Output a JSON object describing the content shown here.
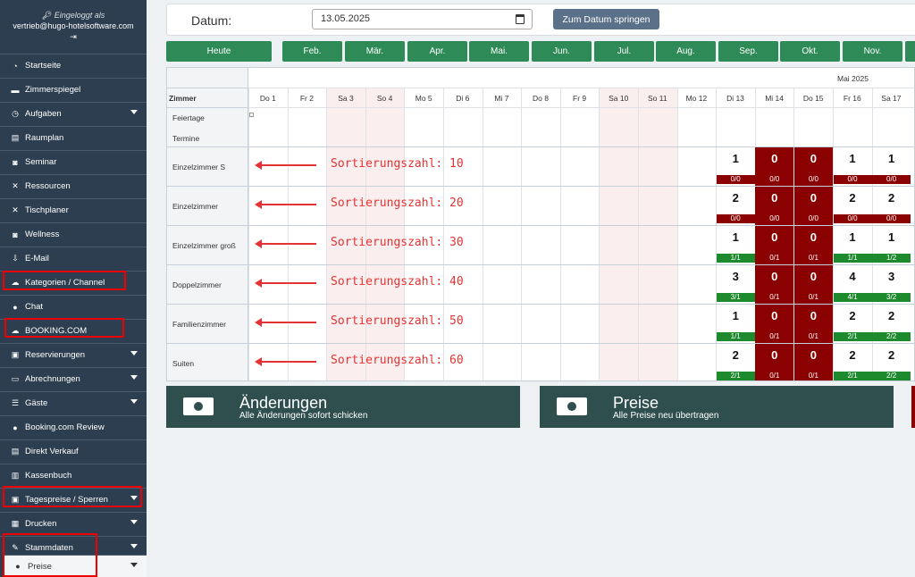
{
  "sidebar": {
    "logged_in_label": "Eingeloggt als",
    "email": "vertrieb@hugo-hotelsoftware.com",
    "logout_glyph": "⇥",
    "items": [
      {
        "label": "Startseite",
        "icon": "speedometer-icon"
      },
      {
        "label": "Zimmerspiegel",
        "icon": "bed-icon"
      },
      {
        "label": "Aufgaben",
        "icon": "clock-icon"
      },
      {
        "label": "Raumplan",
        "icon": "building-icon"
      },
      {
        "label": "Seminar",
        "icon": "cup-icon"
      },
      {
        "label": "Ressourcen",
        "icon": "tools-icon"
      },
      {
        "label": "Tischplaner",
        "icon": "cutlery-icon"
      },
      {
        "label": "Wellness",
        "icon": "spa-icon"
      },
      {
        "label": "E-Mail",
        "icon": "mail-icon"
      },
      {
        "label": "Kategorien / Channel",
        "icon": "cloud-icon"
      },
      {
        "label": "Chat",
        "icon": "chat-icon"
      },
      {
        "label": "BOOKING.COM",
        "icon": "cloud-icon"
      },
      {
        "label": "Reservierungen",
        "icon": "briefcase-icon"
      },
      {
        "label": "Abrechnungen",
        "icon": "cash-icon"
      },
      {
        "label": "Gäste",
        "icon": "list-icon"
      },
      {
        "label": "Booking.com Review",
        "icon": "chat-icon"
      },
      {
        "label": "Direkt Verkauf",
        "icon": "doc-icon"
      },
      {
        "label": "Kassenbuch",
        "icon": "book-icon"
      },
      {
        "label": "Tagespreise / Sperren",
        "icon": "lock-icon"
      },
      {
        "label": "Drucken",
        "icon": "printer-icon"
      },
      {
        "label": "Stammdaten",
        "icon": "edit-icon"
      },
      {
        "label": "Preise",
        "icon": "coin-icon"
      }
    ]
  },
  "toolbar": {
    "date_label": "Datum:",
    "date_value": "13.05.2025",
    "jump_label": "Zum Datum springen"
  },
  "months": [
    "Heute",
    "Feb.",
    "Mär.",
    "Apr.",
    "Mai.",
    "Jun.",
    "Jul.",
    "Aug.",
    "Sep.",
    "Okt.",
    "Nov.",
    ""
  ],
  "grid": {
    "month_header": "Mai 2025",
    "room_col_header": "Zimmer",
    "days": [
      "Do 1",
      "Fr 2",
      "Sa 3",
      "So 4",
      "Mo 5",
      "Di 6",
      "Mi 7",
      "Do 8",
      "Fr 9",
      "Sa 10",
      "So 11",
      "Mo 12",
      "Di 13",
      "Mi 14",
      "Do 15",
      "Fr 16",
      "Sa 17"
    ],
    "special_rows": [
      "Feiertage",
      "Termine"
    ],
    "rooms": [
      {
        "name": "Einzelzimmer S",
        "note": "Sortierungszahl: 10",
        "cells": [
          {
            "n": "1",
            "s": "0/0",
            "red": false,
            "bar": "r"
          },
          {
            "n": "0",
            "s": "0/0",
            "red": true,
            "bar": "r"
          },
          {
            "n": "0",
            "s": "0/0",
            "red": true,
            "bar": "r"
          },
          {
            "n": "1",
            "s": "0/0",
            "red": false,
            "bar": "r"
          },
          {
            "n": "1",
            "s": "0/0",
            "red": false,
            "bar": "r"
          }
        ]
      },
      {
        "name": "Einzelzimmer",
        "note": "Sortierungszahl: 20",
        "cells": [
          {
            "n": "2",
            "s": "0/0",
            "red": false,
            "bar": "r"
          },
          {
            "n": "0",
            "s": "0/0",
            "red": true,
            "bar": "r"
          },
          {
            "n": "0",
            "s": "0/0",
            "red": true,
            "bar": "r"
          },
          {
            "n": "2",
            "s": "0/0",
            "red": false,
            "bar": "r"
          },
          {
            "n": "2",
            "s": "0/0",
            "red": false,
            "bar": "r"
          }
        ]
      },
      {
        "name": "Einzelzimmer groß",
        "note": "Sortierungszahl: 30",
        "cells": [
          {
            "n": "1",
            "s": "1/1",
            "red": false,
            "bar": "g"
          },
          {
            "n": "0",
            "s": "0/1",
            "red": true,
            "bar": "r"
          },
          {
            "n": "0",
            "s": "0/1",
            "red": true,
            "bar": "r"
          },
          {
            "n": "1",
            "s": "1/1",
            "red": false,
            "bar": "g"
          },
          {
            "n": "1",
            "s": "1/2",
            "red": false,
            "bar": "g"
          }
        ]
      },
      {
        "name": "Doppelzimmer",
        "note": "Sortierungszahl: 40",
        "cells": [
          {
            "n": "3",
            "s": "3/1",
            "red": false,
            "bar": "g"
          },
          {
            "n": "0",
            "s": "0/1",
            "red": true,
            "bar": "r"
          },
          {
            "n": "0",
            "s": "0/1",
            "red": true,
            "bar": "r"
          },
          {
            "n": "4",
            "s": "4/1",
            "red": false,
            "bar": "g"
          },
          {
            "n": "3",
            "s": "3/2",
            "red": false,
            "bar": "g"
          }
        ]
      },
      {
        "name": "Familienzimmer",
        "note": "Sortierungszahl: 50",
        "cells": [
          {
            "n": "1",
            "s": "1/1",
            "red": false,
            "bar": "g"
          },
          {
            "n": "0",
            "s": "0/1",
            "red": true,
            "bar": "r"
          },
          {
            "n": "0",
            "s": "0/1",
            "red": true,
            "bar": "r"
          },
          {
            "n": "2",
            "s": "2/1",
            "red": false,
            "bar": "g"
          },
          {
            "n": "2",
            "s": "2/2",
            "red": false,
            "bar": "g"
          }
        ]
      },
      {
        "name": "Suiten",
        "note": "Sortierungszahl: 60",
        "cells": [
          {
            "n": "2",
            "s": "2/1",
            "red": false,
            "bar": "g"
          },
          {
            "n": "0",
            "s": "0/1",
            "red": true,
            "bar": "r"
          },
          {
            "n": "0",
            "s": "0/1",
            "red": true,
            "bar": "r"
          },
          {
            "n": "2",
            "s": "2/1",
            "red": false,
            "bar": "g"
          },
          {
            "n": "2",
            "s": "2/2",
            "red": false,
            "bar": "g"
          }
        ]
      }
    ]
  },
  "actions": [
    {
      "title": "Änderungen",
      "subtitle": "Alle Änderungen sofort schicken"
    },
    {
      "title": "Preise",
      "subtitle": "Alle Preise neu übertragen"
    }
  ],
  "colors": {
    "sidebar": "#2c3e50",
    "month_button": "#2e8b57",
    "blocked": "#8b0000",
    "ok": "#1d8a2e",
    "highlight": "#e00000",
    "annotation": "#e53333"
  }
}
